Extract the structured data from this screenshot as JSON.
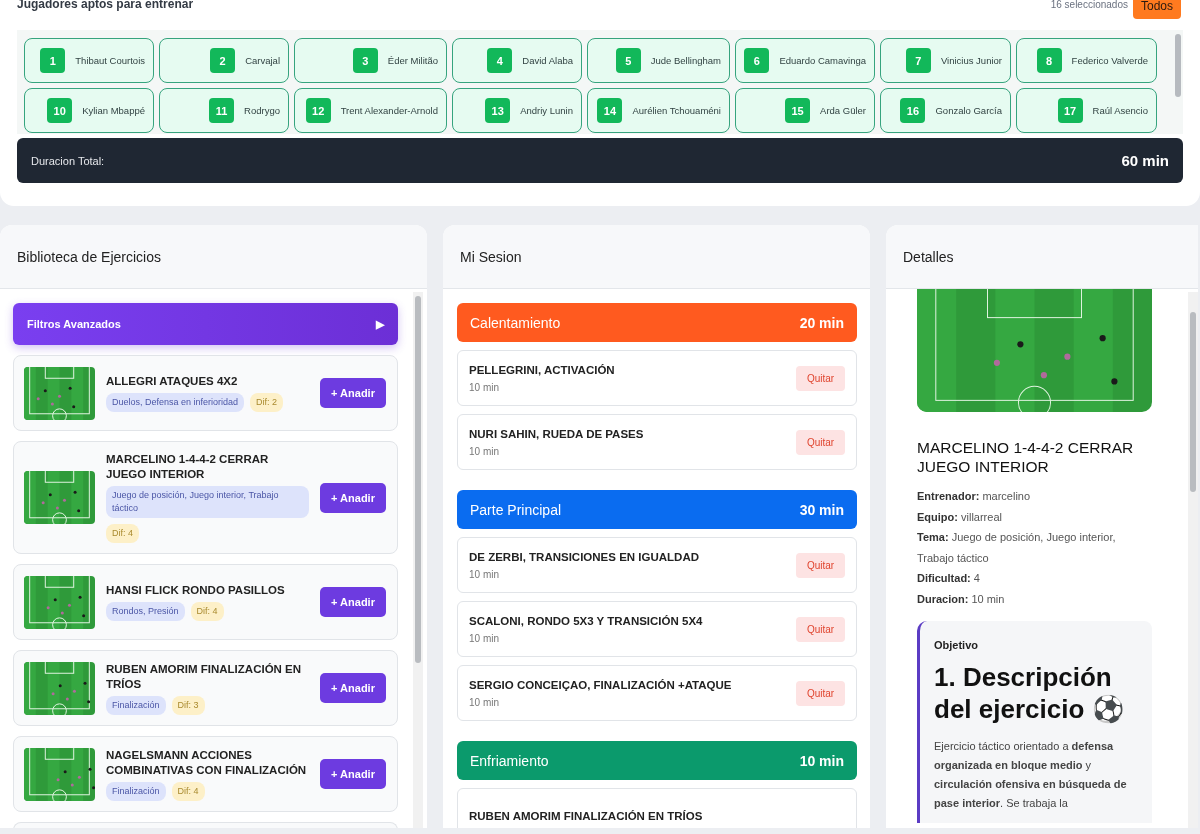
{
  "header": {
    "title": "Jugadores aptos para entrenar",
    "count": "16 seleccionados",
    "all_button": "Todos"
  },
  "players": [
    {
      "number": "1",
      "name": "Thibaut Courtois",
      "selected": true
    },
    {
      "number": "2",
      "name": "Carvajal",
      "selected": true
    },
    {
      "number": "3",
      "name": "Éder Militão",
      "selected": true
    },
    {
      "number": "4",
      "name": "David Alaba",
      "selected": true
    },
    {
      "number": "5",
      "name": "Jude Bellingham",
      "selected": true
    },
    {
      "number": "6",
      "name": "Eduardo Camavinga",
      "selected": true
    },
    {
      "number": "7",
      "name": "Vinicius Junior",
      "selected": true
    },
    {
      "number": "8",
      "name": "Federico Valverde",
      "selected": true
    },
    {
      "number": "10",
      "name": "Kylian Mbappé",
      "selected": true
    },
    {
      "number": "11",
      "name": "Rodrygo",
      "selected": true
    },
    {
      "number": "12",
      "name": "Trent Alexander-Arnold",
      "selected": true
    },
    {
      "number": "13",
      "name": "Andriy Lunin",
      "selected": true
    },
    {
      "number": "14",
      "name": "Aurélien Tchouaméni",
      "selected": true
    },
    {
      "number": "15",
      "name": "Arda Güler",
      "selected": true
    },
    {
      "number": "16",
      "name": "Gonzalo García",
      "selected": true
    },
    {
      "number": "17",
      "name": "Raúl Asencio",
      "selected": true
    }
  ],
  "total": {
    "label": "Duracion Total:",
    "value": "60 min"
  },
  "library": {
    "title": "Biblioteca de Ejercicios",
    "filters": "Filtros Avanzados",
    "filters_icon": "▶",
    "exercises": [
      {
        "title": "ALLEGRI ATAQUES 4X2",
        "tags": "Duelos, Defensa en inferioridad",
        "difficulty": "Dif: 2",
        "add": "+ Anadir"
      },
      {
        "title": "MARCELINO 1-4-4-2 CERRAR JUEGO INTERIOR",
        "tags": "Juego de posición, Juego interior, Trabajo táctico",
        "difficulty": "Dif: 4",
        "add": "+ Anadir"
      },
      {
        "title": "HANSI FLICK RONDO PASILLOS",
        "tags": "Rondos, Presión",
        "difficulty": "Dif: 4",
        "add": "+ Anadir"
      },
      {
        "title": "RUBEN AMORIM FINALIZACIÓN EN TRÍOS",
        "tags": "Finalización",
        "difficulty": "Dif: 3",
        "add": "+ Anadir"
      },
      {
        "title": "NAGELSMANN ACCIONES COMBINATIVAS CON FINALIZACIÓN",
        "tags": "Finalización",
        "difficulty": "Dif: 4",
        "add": "+ Anadir"
      }
    ]
  },
  "session": {
    "title": "Mi Sesion",
    "blocks": [
      {
        "name": "Calentamiento",
        "duration": "20 min",
        "color": "#ff5a1f",
        "items": [
          {
            "title": "PELLEGRINI, ACTIVACIÓN",
            "duration": "10 min",
            "remove": "Quitar"
          },
          {
            "title": "NURI SAHIN, RUEDA DE PASES",
            "duration": "10 min",
            "remove": "Quitar"
          }
        ]
      },
      {
        "name": "Parte Principal",
        "duration": "30 min",
        "color": "#0a6cf0",
        "items": [
          {
            "title": "DE ZERBI, TRANSICIONES EN IGUALDAD",
            "duration": "10 min",
            "remove": "Quitar"
          },
          {
            "title": "SCALONI, RONDO 5X3 Y TRANSICIÓN 5X4",
            "duration": "10 min",
            "remove": "Quitar"
          },
          {
            "title": "SERGIO CONCEIÇAO, FINALIZACIÓN +ATAQUE",
            "duration": "10 min",
            "remove": "Quitar"
          }
        ]
      },
      {
        "name": "Enfriamiento",
        "duration": "10 min",
        "color": "#0b9a6c",
        "items": [
          {
            "title": "RUBEN AMORIM FINALIZACIÓN EN TRÍOS"
          }
        ]
      }
    ]
  },
  "details": {
    "title": "Detalles",
    "exercise_title": "MARCELINO 1-4-4-2 CERRAR JUEGO INTERIOR",
    "facts": [
      "**Entrenador:** marcelino",
      "**Equipo:** villarreal",
      "**Tema:** Juego de posición, Juego interior, Trabajo táctico",
      "**Dificultad:** 4",
      "**Duracion:** 10 min"
    ],
    "objective": {
      "label": "Objetivo",
      "heading": "1. Descripción del ejercicio ⚽",
      "text": "Ejercicio táctico orientado a **defensa organizada en bloque medio** y **circulación ofensiva en búsqueda de pase interior**. Se trabaja la"
    }
  }
}
